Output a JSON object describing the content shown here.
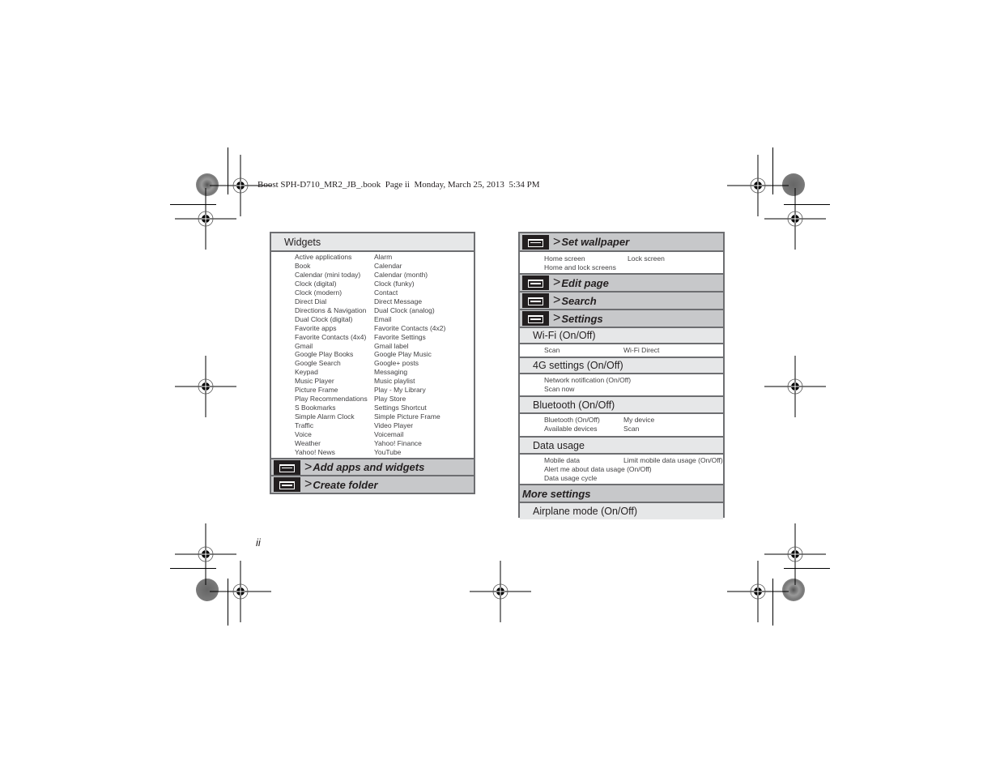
{
  "header": {
    "text": "Boost SPH-D710_MR2_JB_.book  Page ii  Monday, March 25, 2013  5:34 PM"
  },
  "page_number": "ii",
  "left_table": {
    "title": "Widgets",
    "widgets": [
      [
        "Active applications",
        "Alarm"
      ],
      [
        "Book",
        "Calendar"
      ],
      [
        "Calendar (mini today)",
        "Calendar (month)"
      ],
      [
        "Clock (digital)",
        "Clock (funky)"
      ],
      [
        "Clock (modern)",
        "Contact"
      ],
      [
        "Direct Dial",
        "Direct Message"
      ],
      [
        "Directions & Navigation",
        "Dual Clock (analog)"
      ],
      [
        "Dual Clock (digital)",
        "Email"
      ],
      [
        "Favorite apps",
        "Favorite Contacts (4x2)"
      ],
      [
        "Favorite Contacts (4x4)",
        "Favorite Settings"
      ],
      [
        "Gmail",
        "Gmail label"
      ],
      [
        "Google Play Books",
        "Google Play Music"
      ],
      [
        "Google Search",
        "Google+ posts"
      ],
      [
        "Keypad",
        "Messaging"
      ],
      [
        "Music Player",
        "Music playlist"
      ],
      [
        "Picture Frame",
        "Play - My Library"
      ],
      [
        "Play Recommendations",
        "Play Store"
      ],
      [
        "S Bookmarks",
        "Settings Shortcut"
      ],
      [
        "Simple Alarm Clock",
        "Simple Picture Frame"
      ],
      [
        "Traffic",
        "Video Player"
      ],
      [
        "Voice",
        "Voicemail"
      ],
      [
        "Weather",
        "Yahoo! Finance"
      ],
      [
        "Yahoo! News",
        "YouTube"
      ]
    ],
    "menu_rows": [
      {
        "gt": ">",
        "label": "Add apps and widgets",
        "icon": "menu-key-icon"
      },
      {
        "gt": ">",
        "label": "Create folder",
        "icon": "menu-key-icon"
      }
    ]
  },
  "right_table": {
    "set_wallpaper": {
      "gt": ">",
      "label": "Set wallpaper",
      "icon": "menu-key-icon",
      "items": [
        [
          "Home screen",
          "Lock screen"
        ],
        [
          "Home and lock screens",
          ""
        ]
      ]
    },
    "edit_page": {
      "gt": ">",
      "label": "Edit page",
      "icon": "menu-key-icon"
    },
    "search": {
      "gt": ">",
      "label": "Search",
      "icon": "menu-key-icon"
    },
    "settings": {
      "gt": ">",
      "label": "Settings",
      "icon": "menu-key-icon"
    },
    "wifi": {
      "title": "Wi-Fi (On/Off)",
      "items": [
        [
          "Scan",
          "Wi-Fi Direct"
        ]
      ]
    },
    "four_g": {
      "title": "4G settings (On/Off)",
      "items": [
        [
          "Network notification (On/Off)",
          ""
        ],
        [
          "Scan now",
          ""
        ]
      ]
    },
    "bluetooth": {
      "title": "Bluetooth (On/Off)",
      "items": [
        [
          "Bluetooth (On/Off)",
          "My device"
        ],
        [
          "Available devices",
          "Scan"
        ]
      ]
    },
    "data_usage": {
      "title": "Data usage",
      "items": [
        [
          "Mobile data",
          "Limit mobile data usage (On/Off)"
        ],
        [
          "Alert me about data usage (On/Off)",
          ""
        ],
        [
          "Data usage cycle",
          ""
        ]
      ]
    },
    "more_settings": {
      "label": "More settings"
    },
    "airplane": {
      "title": "Airplane mode (On/Off)"
    }
  },
  "colors": {
    "border": "#6d6e71",
    "light_gray": "#e6e7e8",
    "mid_gray": "#c7c8ca",
    "text": "#231f20"
  }
}
